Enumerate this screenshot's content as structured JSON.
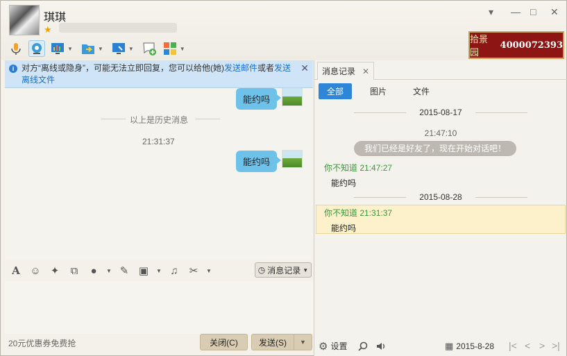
{
  "contact": {
    "name": "琪琪",
    "star": "★"
  },
  "window_controls": {
    "menu": "▾",
    "minimize": "—",
    "maximize": "□",
    "close": "✕"
  },
  "ad": {
    "brand": "拾景园",
    "phone": "4000072393"
  },
  "notice": {
    "text_prefix": "对方“离线或隐身”，可能无法立即回复，您可以给他(她)",
    "link_email": "发送邮件",
    "text_mid": "或者",
    "link_offline": "发送离线文件",
    "close": "✕"
  },
  "chat": {
    "top_bubble": "能约吗",
    "history_divider": "以上是历史消息",
    "timestamp": "21:31:37",
    "bubble": "能约吗"
  },
  "input_toolbar": {
    "history_button": "消息记录"
  },
  "footer": {
    "promo": "20元优惠券免费抢",
    "close_button": "关闭(C)",
    "send_button": "发送(S)"
  },
  "history_panel": {
    "tab_label": "消息记录",
    "filters": [
      "全部",
      "图片",
      "文件"
    ],
    "active_filter": "全部",
    "entries": {
      "date1": "2015-08-17",
      "sys_time": "21:47:10",
      "sys_msg": "我们已经是好友了，现在开始对话吧！",
      "sender1": "你不知道 21:47:27",
      "msg1": "能约吗",
      "date2": "2015-08-28",
      "sender2": "你不知道 21:31:37",
      "msg2": "能约吗"
    },
    "settings_label": "设置",
    "current_date": "2015-8-28"
  },
  "colors": {
    "accent_blue": "#2d86d7",
    "bubble_blue": "#6ec2ea",
    "sender_green": "#3a9a3a",
    "highlight_yellow": "#fdf1cc"
  }
}
